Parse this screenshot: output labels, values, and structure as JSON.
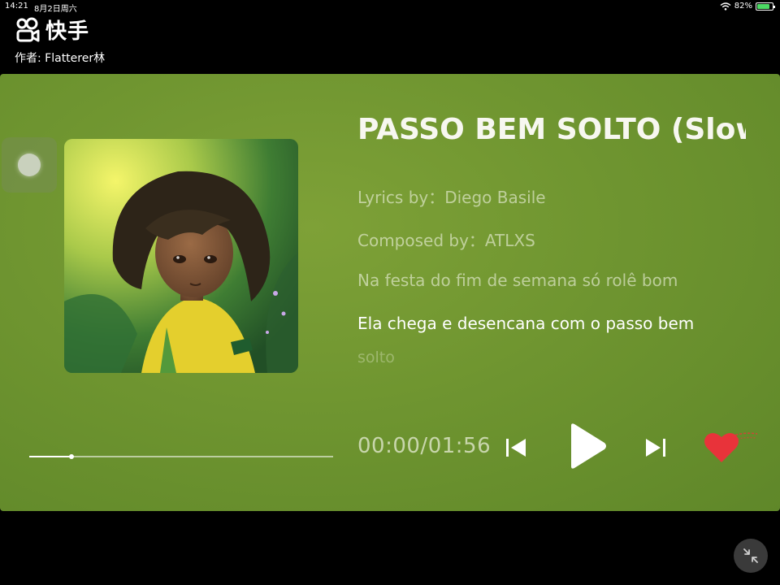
{
  "status_bar": {
    "time": "14:21",
    "date": "8月2日周六",
    "battery_percent": "82%",
    "battery_level": 0.82
  },
  "app": {
    "brand": "快手",
    "author": "作者: Flatterer林"
  },
  "player": {
    "title": "PASSO BEM SOLTO (Slowed)",
    "lyrics": [
      "Lyrics by：Diego Basile",
      "Composed by：ATLXS",
      "Na festa do fim de semana só rolê bom",
      "Ela chega e desencana com o passo bem",
      "solto"
    ],
    "active_lyric_index": 3,
    "time_display": "00:00/01:56",
    "progress_fraction": 0.14
  },
  "colors": {
    "card_green": "#6f9530",
    "heart_red": "#e8333a",
    "battery_green": "#4cd964"
  },
  "icons": {
    "prev": "skip-previous-icon",
    "play": "play-icon",
    "next": "skip-next-icon",
    "like": "heart-icon",
    "minimize": "minimize-arrows-icon"
  }
}
